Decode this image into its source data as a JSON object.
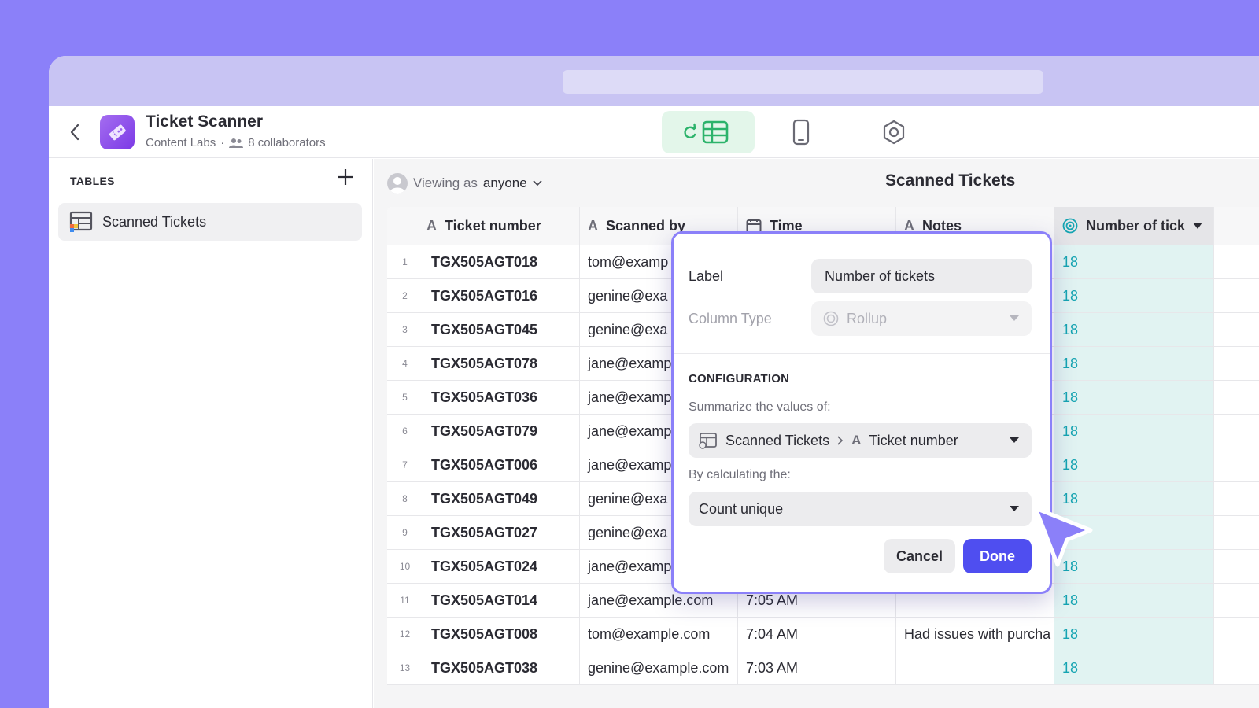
{
  "app": {
    "title": "Ticket Scanner",
    "workspace": "Content Labs",
    "separator": "·",
    "collaborators": "8 collaborators"
  },
  "nav": {
    "tabs": [
      {
        "icon": "table-refresh-icon",
        "active": true
      },
      {
        "icon": "mobile-icon",
        "active": false
      },
      {
        "icon": "settings-hex-icon",
        "active": false
      }
    ]
  },
  "sidebar": {
    "heading": "TABLES",
    "items": [
      {
        "label": "Scanned Tickets",
        "icon": "table-icon"
      }
    ]
  },
  "main": {
    "viewing_prefix": "Viewing as",
    "viewing_user": "anyone",
    "title": "Scanned Tickets"
  },
  "table": {
    "columns": [
      {
        "label": "Ticket number",
        "icon": "A"
      },
      {
        "label": "Scanned by",
        "icon": "A"
      },
      {
        "label": "Time",
        "icon": "calendar-icon"
      },
      {
        "label": "Notes",
        "icon": "A"
      },
      {
        "label": "Number of tick",
        "icon": "rollup-icon"
      }
    ],
    "rows": [
      {
        "idx": "1",
        "ticket": "TGX505AGT018",
        "by": "tom@examp",
        "time": "",
        "notes": "",
        "num": "18"
      },
      {
        "idx": "2",
        "ticket": "TGX505AGT016",
        "by": "genine@exa",
        "time": "",
        "notes": "",
        "num": "18"
      },
      {
        "idx": "3",
        "ticket": "TGX505AGT045",
        "by": "genine@exa",
        "time": "",
        "notes": "",
        "num": "18"
      },
      {
        "idx": "4",
        "ticket": "TGX505AGT078",
        "by": "jane@examp",
        "time": "",
        "notes": "",
        "num": "18"
      },
      {
        "idx": "5",
        "ticket": "TGX505AGT036",
        "by": "jane@examp",
        "time": "",
        "notes": "",
        "num": "18"
      },
      {
        "idx": "6",
        "ticket": "TGX505AGT079",
        "by": "jane@examp",
        "time": "",
        "notes": "",
        "num": "18"
      },
      {
        "idx": "7",
        "ticket": "TGX505AGT006",
        "by": "jane@examp",
        "time": "",
        "notes": "",
        "num": "18"
      },
      {
        "idx": "8",
        "ticket": "TGX505AGT049",
        "by": "genine@exa",
        "time": "",
        "notes": "",
        "num": "18"
      },
      {
        "idx": "9",
        "ticket": "TGX505AGT027",
        "by": "genine@exa",
        "time": "",
        "notes": "",
        "num": ""
      },
      {
        "idx": "10",
        "ticket": "TGX505AGT024",
        "by": "jane@examp",
        "time": "",
        "notes": "",
        "num": "18"
      },
      {
        "idx": "11",
        "ticket": "TGX505AGT014",
        "by": "jane@example.com",
        "time": "7:05 AM",
        "notes": "",
        "num": "18"
      },
      {
        "idx": "12",
        "ticket": "TGX505AGT008",
        "by": "tom@example.com",
        "time": "7:04 AM",
        "notes": "Had issues with purcha",
        "num": "18"
      },
      {
        "idx": "13",
        "ticket": "TGX505AGT038",
        "by": "genine@example.com",
        "time": "7:03 AM",
        "notes": "",
        "num": "18"
      }
    ]
  },
  "popover": {
    "label_label": "Label",
    "label_value": "Number of tickets",
    "column_type_label": "Column Type",
    "column_type_value": "Rollup",
    "configuration_heading": "CONFIGURATION",
    "summarize_hint": "Summarize the values of:",
    "summarize_table": "Scanned Tickets",
    "summarize_column": "Ticket number",
    "summarize_column_icon": "A",
    "calc_hint": "By calculating the:",
    "calc_value": "Count unique",
    "cancel_label": "Cancel",
    "done_label": "Done"
  },
  "colors": {
    "background": "#8b80f9",
    "accent": "#4f4ef0",
    "rollup_cell": "#e1f3f2",
    "rollup_text": "#15a4b2",
    "active_tab": "#e3f6ea"
  }
}
